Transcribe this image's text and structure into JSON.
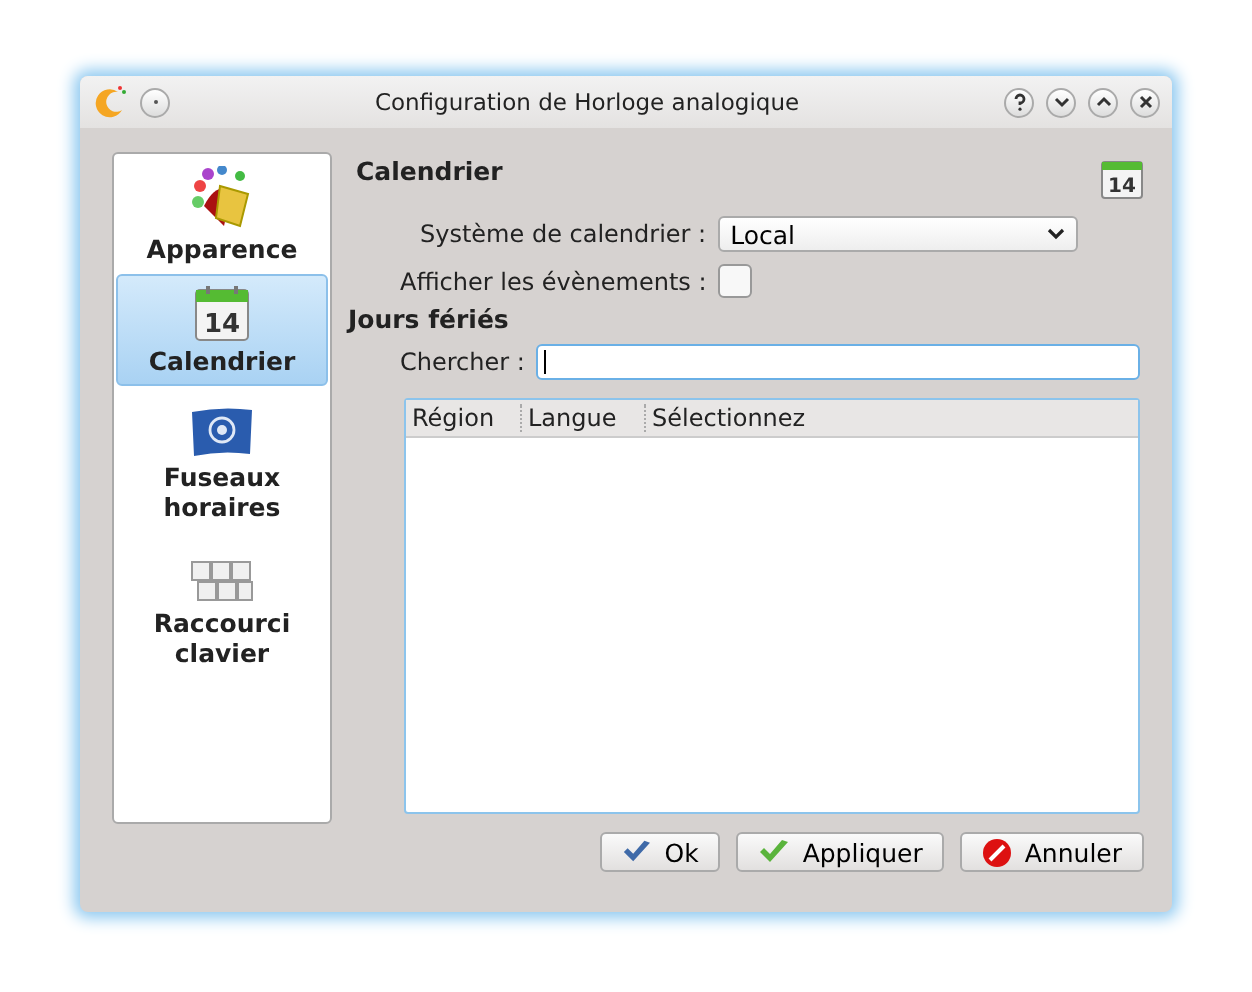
{
  "window": {
    "title": "Configuration de Horloge analogique"
  },
  "sidebar": {
    "items": [
      {
        "label": "Apparence",
        "kind": "paint",
        "selected": false
      },
      {
        "label": "Calendrier",
        "kind": "calendar",
        "icon_text": "14",
        "selected": true
      },
      {
        "label": "Fuseaux horaires",
        "kind": "flag",
        "selected": false
      },
      {
        "label": "Raccourci clavier",
        "kind": "keyboard",
        "selected": false
      }
    ]
  },
  "page": {
    "title": "Calendrier",
    "icon_text": "14",
    "calendar_system": {
      "label": "Système de calendrier :",
      "value": "Local"
    },
    "show_events": {
      "label": "Afficher les évènements :",
      "checked": false
    },
    "holidays": {
      "title": "Jours fériés",
      "search": {
        "label": "Chercher :"
      },
      "table": {
        "columns": [
          "Région",
          "Langue",
          "Sélectionnez"
        ]
      }
    }
  },
  "buttons": [
    {
      "label": "Ok",
      "kind": "ok"
    },
    {
      "label": "Appliquer",
      "kind": "apply"
    },
    {
      "label": "Annuler",
      "kind": "cancel"
    }
  ]
}
